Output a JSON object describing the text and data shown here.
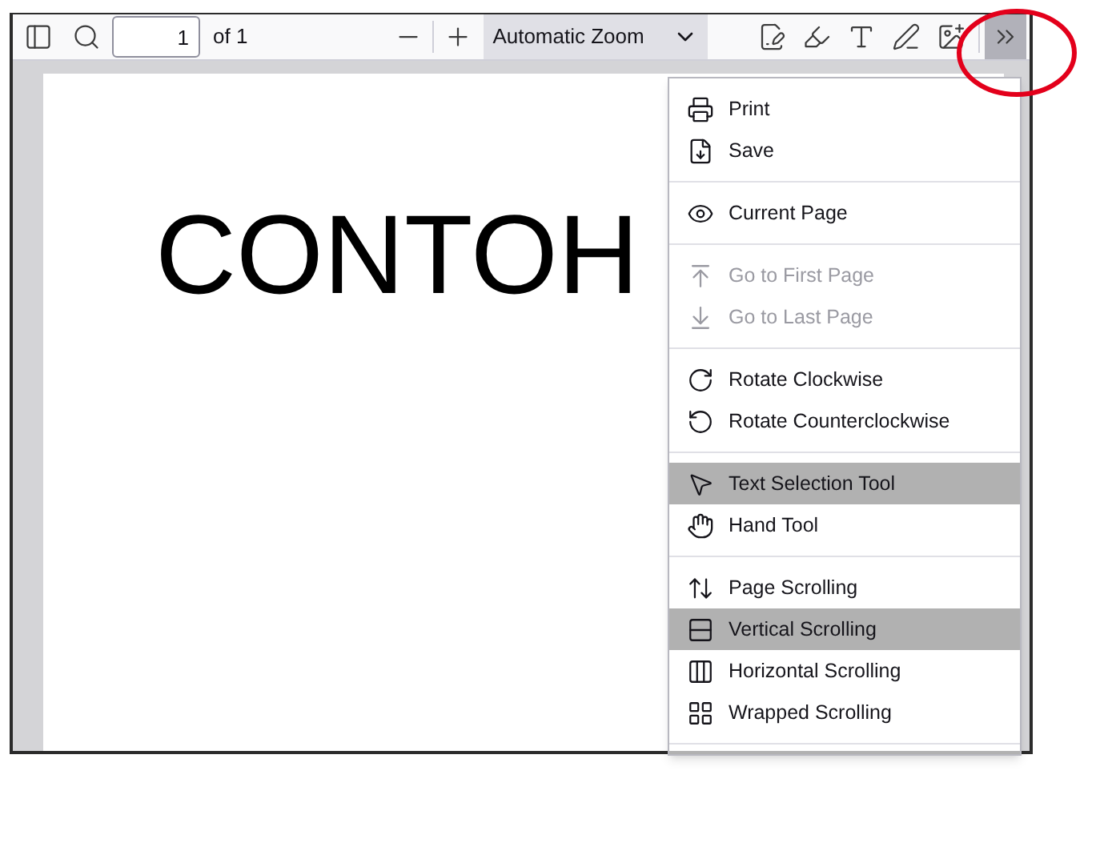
{
  "toolbar": {
    "page_number": "1",
    "page_count": "of 1",
    "zoom": "Automatic Zoom",
    "more_tools_pressed": true
  },
  "document": {
    "heading": "CONTOH"
  },
  "menu": {
    "groups": [
      {
        "items": [
          {
            "kind": "print",
            "label": "Print",
            "disabled": false,
            "selected": false
          },
          {
            "kind": "save",
            "label": "Save",
            "disabled": false,
            "selected": false
          }
        ]
      },
      {
        "items": [
          {
            "kind": "view",
            "label": "Current Page",
            "disabled": false,
            "selected": false
          }
        ]
      },
      {
        "items": [
          {
            "kind": "first",
            "label": "Go to First Page",
            "disabled": true,
            "selected": false
          },
          {
            "kind": "last",
            "label": "Go to Last Page",
            "disabled": true,
            "selected": false
          }
        ]
      },
      {
        "items": [
          {
            "kind": "cw",
            "label": "Rotate Clockwise",
            "disabled": false,
            "selected": false
          },
          {
            "kind": "ccw",
            "label": "Rotate Counterclockwise",
            "disabled": false,
            "selected": false
          }
        ]
      },
      {
        "items": [
          {
            "kind": "cursor",
            "label": "Text Selection Tool",
            "disabled": false,
            "selected": true
          },
          {
            "kind": "hand",
            "label": "Hand Tool",
            "disabled": false,
            "selected": false
          }
        ]
      },
      {
        "items": [
          {
            "kind": "page-scroll",
            "label": "Page Scrolling",
            "disabled": false,
            "selected": false
          },
          {
            "kind": "vertical",
            "label": "Vertical Scrolling",
            "disabled": false,
            "selected": true
          },
          {
            "kind": "horizontal",
            "label": "Horizontal Scrolling",
            "disabled": false,
            "selected": false
          },
          {
            "kind": "wrapped",
            "label": "Wrapped Scrolling",
            "disabled": false,
            "selected": false
          }
        ]
      }
    ]
  },
  "annotation": {
    "kind": "circle",
    "color": "#e3001b"
  }
}
